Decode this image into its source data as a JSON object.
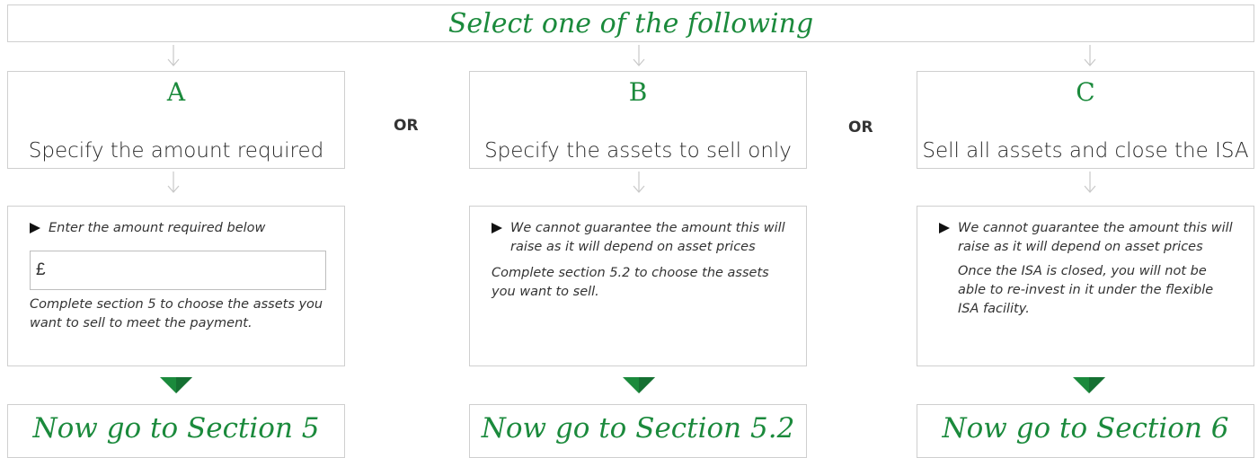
{
  "title": "Select one of the following",
  "or_label": "OR",
  "options": [
    {
      "letter": "A",
      "description": "Specify the amount required",
      "bullet": "Enter the amount required below",
      "currency_symbol": "£",
      "amount_value": "",
      "note": "Complete section 5 to choose the assets you want to sell to meet the payment.",
      "goto": "Now go to Section 5"
    },
    {
      "letter": "B",
      "description": "Specify the assets to sell only",
      "bullet": "We cannot guarantee the amount this will raise as it will depend on asset prices",
      "note": "Complete section 5.2 to choose the assets you want to sell.",
      "goto": "Now go to Section 5.2"
    },
    {
      "letter": "C",
      "description": "Sell all assets and close the ISA",
      "bullet": "We cannot guarantee the amount this will raise as it will depend on asset prices",
      "note": "Once the ISA is closed, you will not be able to re-invest in it under the flexible ISA facility.",
      "goto": "Now go to Section 6"
    }
  ],
  "colors": {
    "accent_green": "#1b8a3c",
    "border": "#cfcfcf"
  }
}
